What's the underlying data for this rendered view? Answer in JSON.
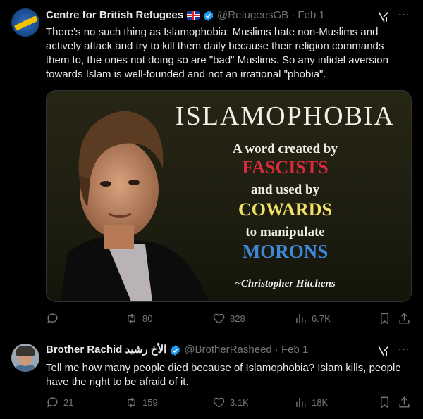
{
  "tweets": [
    {
      "name": "Centre for British Refugees",
      "handle": "@RefugeesGB",
      "date": "· Feb 1",
      "text": "There's no such thing as Islamophobia: Muslims hate non-Muslims and actively attack and try to kill them daily because their religion commands them to, the ones not doing so are \"bad\" Muslims. So any infidel aversion towards Islam is well-founded and not an irrational \"phobia\".",
      "media": {
        "title": "ISLAMOPHOBIA",
        "line1": "A word created by",
        "line2": "FASCISTS",
        "line3": "and used by",
        "line4": "COWARDS",
        "line5": "to manipulate",
        "line6": "MORONS",
        "signature": "~Christopher Hitchens"
      },
      "stats": {
        "replies": "",
        "reposts": "80",
        "likes": "828",
        "views": "6.7K"
      }
    },
    {
      "name": "Brother Rachid الأخ رشيد",
      "handle": "@BrotherRasheed",
      "date": "· Feb 1",
      "text": "Tell me how many people died because of Islamophobia? Islam kills, people have the right to be afraid of it.",
      "stats": {
        "replies": "21",
        "reposts": "159",
        "likes": "3.1K",
        "views": "18K"
      }
    }
  ],
  "icons": {
    "verified": "verified-badge-icon",
    "grok": "grok-icon",
    "more": "more-icon",
    "reply": "reply-icon",
    "repost": "repost-icon",
    "like": "like-icon",
    "views": "views-icon",
    "bookmark": "bookmark-icon",
    "share": "share-icon"
  },
  "colors": {
    "background": "#000000",
    "text": "#e7e9ea",
    "muted": "#71767b",
    "verified": "#1d9bf0",
    "fascists": "#d62b3c",
    "cowards": "#efe06a",
    "morons": "#3f88d8"
  }
}
